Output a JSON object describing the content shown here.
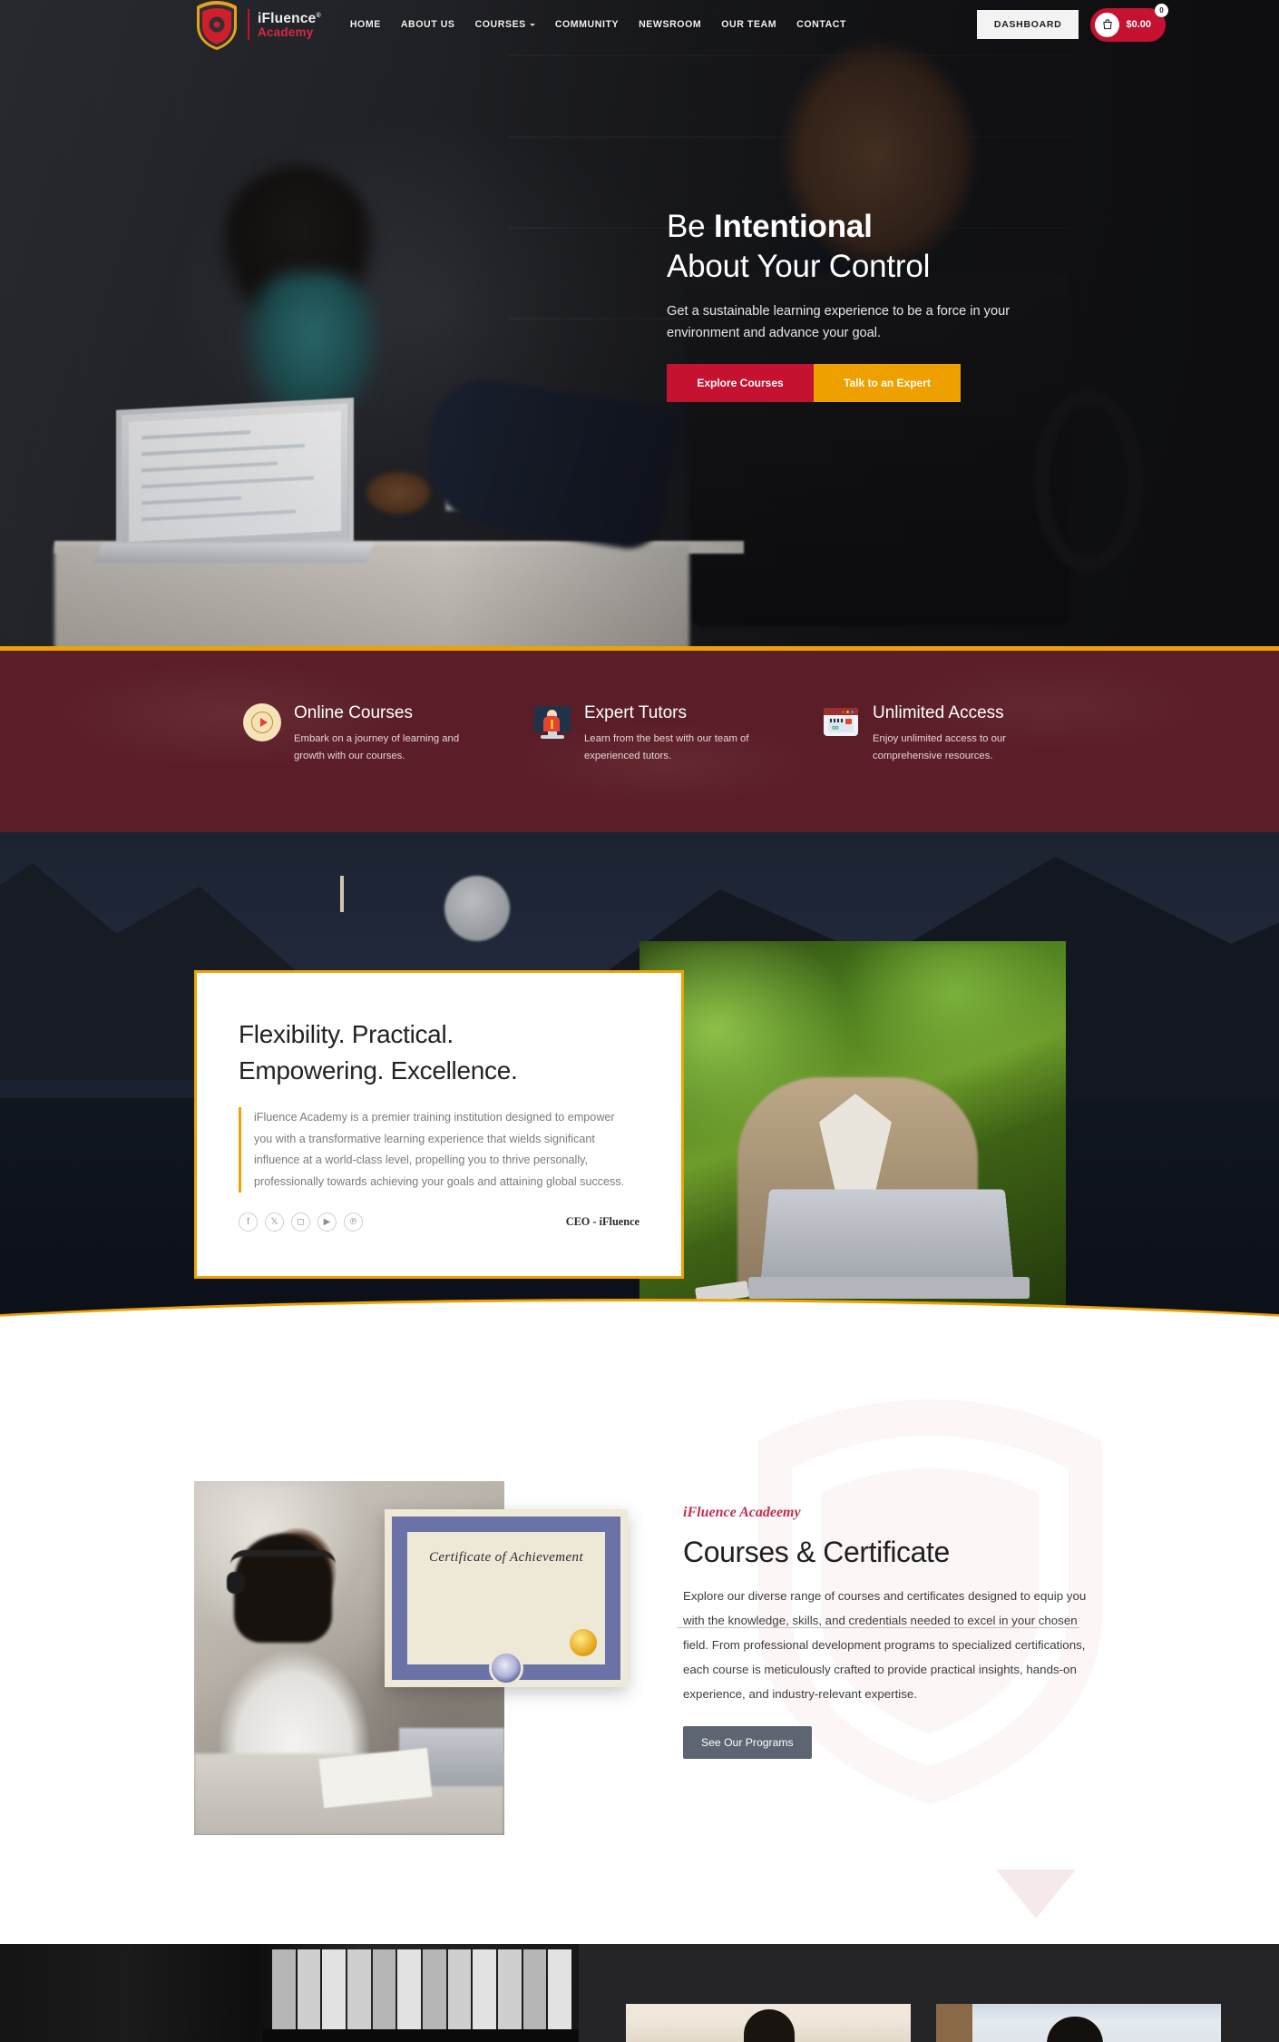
{
  "header": {
    "brand": {
      "line1": "iFluence",
      "line1_sup": "®",
      "line2": "Academy",
      "logo_icon": "shield-logo-icon"
    },
    "nav": [
      {
        "label": "HOME",
        "has_caret": false
      },
      {
        "label": "ABOUT US",
        "has_caret": false
      },
      {
        "label": "COURSES",
        "has_caret": true
      },
      {
        "label": "COMMUNITY",
        "has_caret": false
      },
      {
        "label": "NEWSROOM",
        "has_caret": false
      },
      {
        "label": "OUR TEAM",
        "has_caret": false
      },
      {
        "label": "CONTACT",
        "has_caret": false
      }
    ],
    "dashboard_label": "DASHBOARD",
    "cart": {
      "amount": "$0.00",
      "count": "0",
      "icon": "shopping-bag-icon"
    }
  },
  "hero": {
    "title_light": "Be ",
    "title_bold": "Intentional",
    "title_line2": "About Your Control",
    "paragraph": "Get a sustainable learning experience to be a force in your environment and advance your goal.",
    "btn_primary": "Explore Courses",
    "btn_secondary": "Talk to an Expert"
  },
  "features": [
    {
      "icon": "play-circle-icon",
      "title": "Online Courses",
      "text": "Embark on a journey of learning and growth with our courses."
    },
    {
      "icon": "presenter-monitor-icon",
      "title": "Expert Tutors",
      "text": "Learn from the best with our team of experienced tutors."
    },
    {
      "icon": "browser-infinity-icon",
      "title": "Unlimited Access",
      "text": "Enjoy unlimited access to our comprehensive resources."
    }
  ],
  "about": {
    "heading_line1": "Flexibility. Practical.",
    "heading_line2": "Empowering. Excellence.",
    "paragraph": "iFluence Academy is a premier training institution designed to empower you with a transformative learning experience that wields significant influence at a world-class level, propelling you to thrive personally, professionally towards achieving your goals and attaining global success.",
    "signature": "CEO - iFluence",
    "socials": [
      {
        "name": "facebook-icon",
        "glyph": "f"
      },
      {
        "name": "x-twitter-icon",
        "glyph": "𝕏"
      },
      {
        "name": "instagram-icon",
        "glyph": "◻"
      },
      {
        "name": "youtube-icon",
        "glyph": "▶"
      },
      {
        "name": "pinterest-icon",
        "glyph": "℗"
      }
    ]
  },
  "courses": {
    "eyebrow": "iFluence Acadeemy",
    "heading": "Courses & Certificate",
    "paragraph": "Explore our diverse range of courses and certificates designed to equip you with the knowledge, skills, and credentials needed to excel in your chosen field. From professional development programs to specialized certifications, each course is meticulously crafted to provide practical insights, hands-on experience, and industry-relevant expertise.",
    "button": "See Our Programs",
    "certificate_title": "Certificate of Achievement"
  },
  "colors": {
    "brand_red": "#c41230",
    "brand_amber": "#eda204",
    "band_maroon": "#5b1e29",
    "night_dark": "#1a2230",
    "button_grey": "#5d6572",
    "eyebrow_red": "#c0304c"
  }
}
